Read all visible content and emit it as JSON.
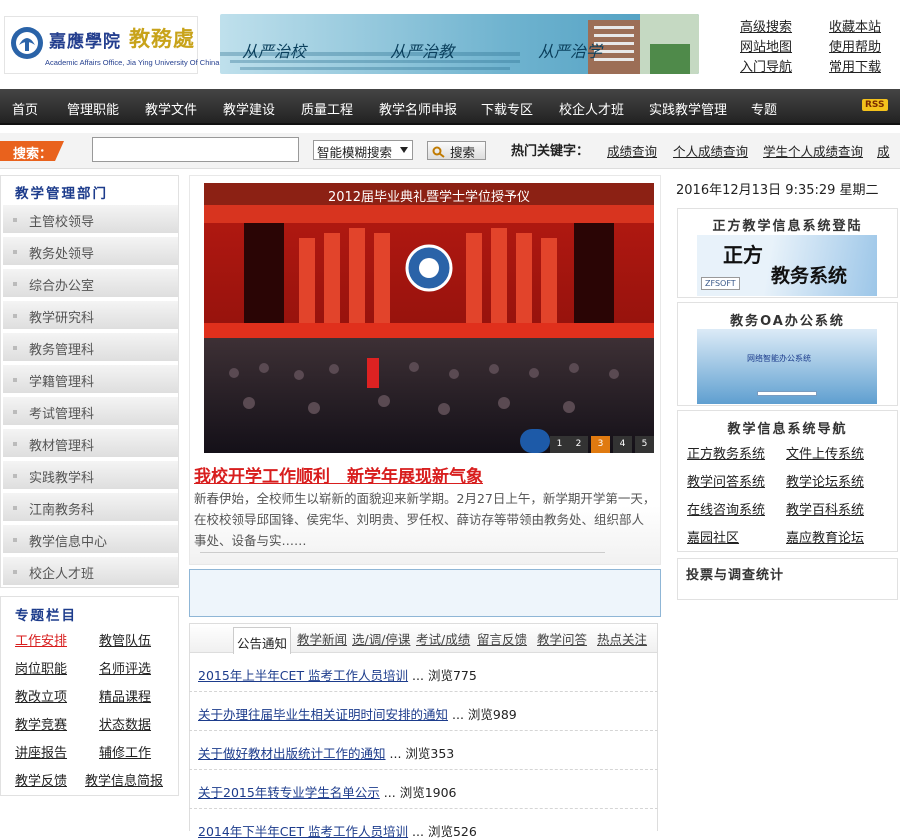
{
  "header": {
    "logo_school": "嘉應學院",
    "logo_dept": "教務處",
    "logo_en": "Academic Affairs Office, Jia Ying University Of China",
    "banner_slogans": [
      "从严治校",
      "从严治教",
      "从严治学"
    ],
    "links": [
      "高级搜索",
      "收藏本站",
      "网站地图",
      "使用帮助",
      "入门导航",
      "常用下载"
    ]
  },
  "nav": {
    "items": [
      "首页",
      "管理职能",
      "教学文件",
      "教学建设",
      "质量工程",
      "教学名师申报",
      "下载专区",
      "校企人才班",
      "实践教学管理",
      "专题"
    ],
    "rss": "RSS"
  },
  "search": {
    "label": "搜索：",
    "input_value": "",
    "mode": "智能模糊搜索",
    "button": "搜索",
    "hot_label": "热门关键字：",
    "hot_keywords": [
      "成绩查询",
      "个人成绩查询",
      "学生个人成绩查询",
      "成"
    ]
  },
  "sidebar": {
    "dept_title": "教学管理部门",
    "departments": [
      "主管校领导",
      "教务处领导",
      "综合办公室",
      "教学研究科",
      "教务管理科",
      "学籍管理科",
      "考试管理科",
      "教材管理科",
      "实践教学科",
      "江南教务科",
      "教学信息中心",
      "校企人才班"
    ],
    "topic_title": "专题栏目",
    "topics": [
      "工作安排",
      "教管队伍",
      "岗位职能",
      "名师评选",
      "教改立项",
      "精品课程",
      "教学竞赛",
      "状态数据",
      "讲座报告",
      "辅修工作",
      "教学反馈",
      "教学信息简报"
    ]
  },
  "slideshow": {
    "caption": "2012届毕业典礼暨学士学位授予仪",
    "pages": [
      "1",
      "2",
      "3",
      "4",
      "5"
    ]
  },
  "headline": {
    "title": "我校开学工作顺利　新学年展现新气象",
    "summary": "新春伊始，全校师生以崭新的面貌迎来新学期。2月27日上午，新学期开学第一天，在校校领导邱国锋、侯宪华、刘明贵、罗任权、薛访存等带领由教务处、组织部人事处、设备与实……"
  },
  "tabs": {
    "active": "公告通知",
    "others": [
      "教学新闻",
      "选/调/停课",
      "考试/成绩",
      "留言反馈",
      "教学问答",
      "热点关注"
    ]
  },
  "notices": [
    {
      "title": "2015年上半年CET 监考工作人员培训",
      "views": "... 浏览775"
    },
    {
      "title": "关于办理往届毕业生相关证明时间安排的通知",
      "views": "... 浏览989"
    },
    {
      "title": "关于做好教材出版统计工作的通知",
      "views": "... 浏览353"
    },
    {
      "title": "关于2015年转专业学生名单公示",
      "views": "... 浏览1906"
    },
    {
      "title": "2014年下半年CET 监考工作人员培训",
      "views": "... 浏览526"
    }
  ],
  "right": {
    "datetime": "2016年12月13日  9:35:29  星期二",
    "zf_title": "正方教学信息系统登陆",
    "zf_banner_text": "正方",
    "zf_banner_text2": "教务系统",
    "zf_brand": "ZFSOFT",
    "oa_title": "教务OA办公系统",
    "oa_banner_text": "网络智能办公系统",
    "info_title": "教学信息系统导航",
    "info_links": [
      "正方教务系统",
      "文件上传系统",
      "教学问答系统",
      "教学论坛系统",
      "在线咨询系统",
      "教学百科系统",
      "嘉园社区",
      "嘉应教育论坛"
    ],
    "vote_title": "投票与调查统计"
  },
  "colors": {
    "nav_bg": "#2b2b2b",
    "accent_orange": "#e9621d",
    "headline_red": "#d81e1e",
    "title_blue": "#1d3c8c"
  }
}
